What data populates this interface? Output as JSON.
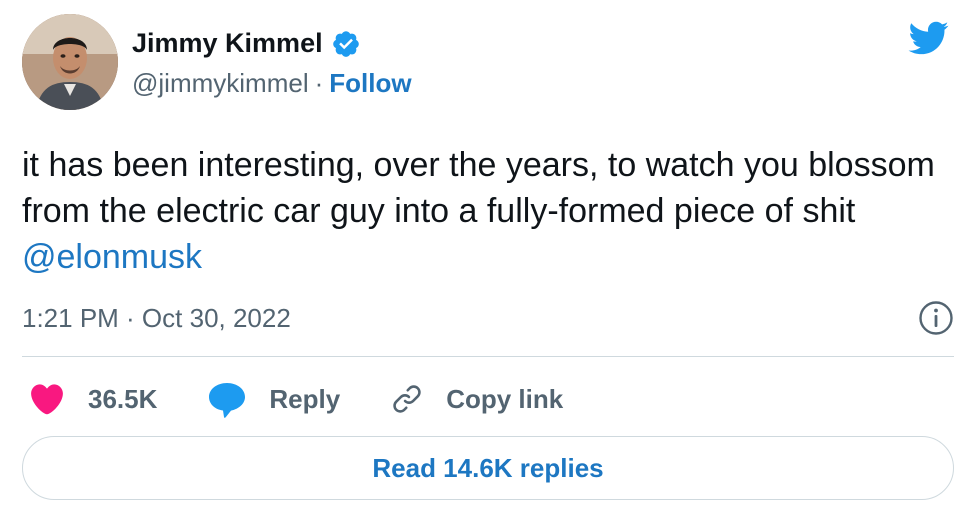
{
  "author": {
    "name": "Jimmy Kimmel",
    "handle": "@jimmykimmel",
    "separator": "·",
    "follow_label": "Follow",
    "verified": true
  },
  "tweet": {
    "text": "it has been interesting, over the years, to watch you blossom from the electric car guy into a fully-formed piece of shit",
    "mention": "@elonmusk",
    "timestamp": "1:21 PM · Oct 30, 2022"
  },
  "actions": {
    "like_count": "36.5K",
    "reply_label": "Reply",
    "copy_link_label": "Copy link"
  },
  "read_replies_label": "Read 14.6K replies",
  "colors": {
    "brand_blue": "#1d9bf0",
    "link_blue": "#1d77c2",
    "like_pink": "#f91880",
    "secondary_text": "#536471"
  },
  "icons": {
    "logo": "twitter-bird-icon",
    "verified": "verified-badge-icon",
    "info": "info-icon",
    "like": "heart-icon",
    "reply": "speech-bubble-icon",
    "copy": "link-icon"
  }
}
